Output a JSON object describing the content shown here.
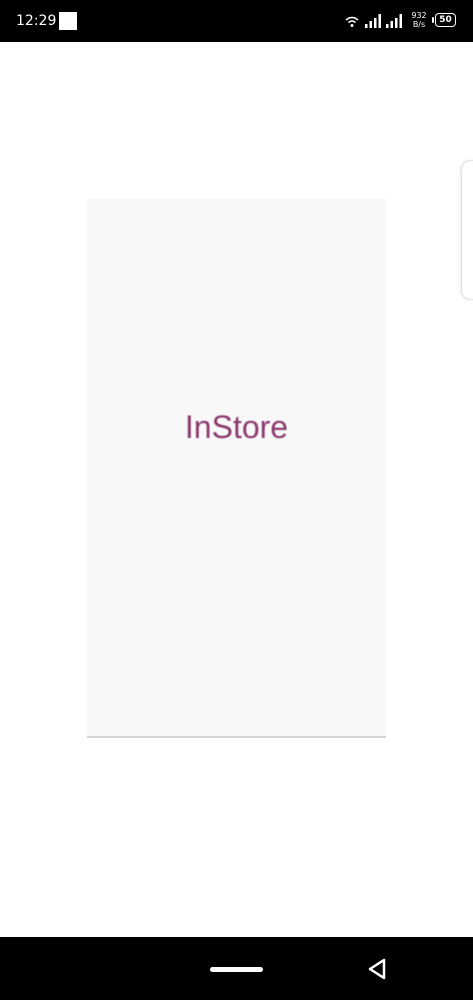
{
  "status_bar": {
    "time": "12:29",
    "net_speed_value": "932",
    "net_speed_unit": "B/s",
    "battery_level": "50",
    "icons": [
      "notification-icon",
      "wifi-icon",
      "signal-icon",
      "signal-icon",
      "battery-icon"
    ]
  },
  "splash": {
    "app_name": "InStore",
    "accent_color": "#8a3b6e"
  },
  "nav_bar": {
    "icons": [
      "home-pill-icon",
      "back-icon"
    ]
  }
}
